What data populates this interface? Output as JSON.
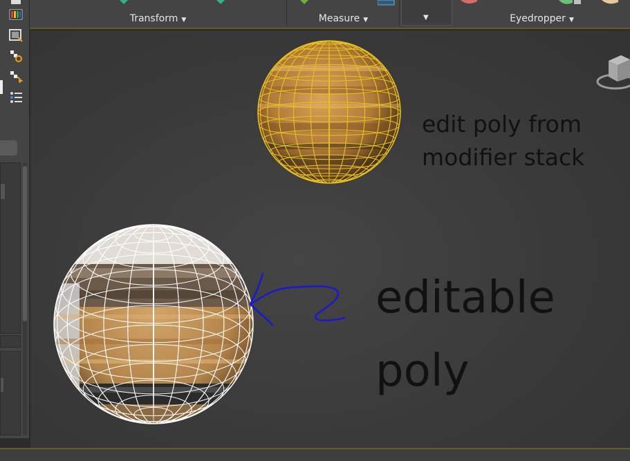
{
  "ribbon": {
    "groups": [
      {
        "label": "Transform"
      },
      {
        "label": "Measure"
      },
      {
        "label": "Eyedropper"
      }
    ]
  },
  "viewport": {
    "annotation_small_line1": "edit poly from",
    "annotation_small_line2": "modifier stack",
    "annotation_big_line1": "editable",
    "annotation_big_line2": "poly",
    "arrow_color": "#1a1acc",
    "wireframe_selected_color": "#e8c020",
    "wireframe_color": "#ffffff"
  },
  "icons": {
    "left_toolbar": [
      "checkerboard-icon",
      "color-bars-icon",
      "render-frame-icon",
      "material-settings-icon",
      "material-pick-icon",
      "list-settings-icon"
    ],
    "viewcube": "viewcube-icon"
  }
}
